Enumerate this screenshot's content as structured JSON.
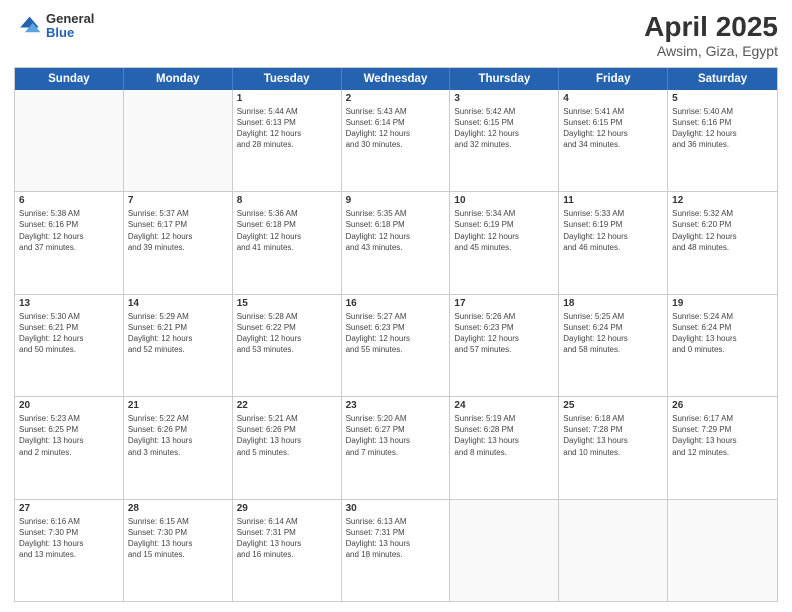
{
  "header": {
    "logo_line1": "General",
    "logo_line2": "Blue",
    "title": "April 2025",
    "subtitle": "Awsim, Giza, Egypt"
  },
  "calendar": {
    "days_of_week": [
      "Sunday",
      "Monday",
      "Tuesday",
      "Wednesday",
      "Thursday",
      "Friday",
      "Saturday"
    ],
    "weeks": [
      [
        {
          "day": "",
          "info": ""
        },
        {
          "day": "",
          "info": ""
        },
        {
          "day": "1",
          "info": "Sunrise: 5:44 AM\nSunset: 6:13 PM\nDaylight: 12 hours\nand 28 minutes."
        },
        {
          "day": "2",
          "info": "Sunrise: 5:43 AM\nSunset: 6:14 PM\nDaylight: 12 hours\nand 30 minutes."
        },
        {
          "day": "3",
          "info": "Sunrise: 5:42 AM\nSunset: 6:15 PM\nDaylight: 12 hours\nand 32 minutes."
        },
        {
          "day": "4",
          "info": "Sunrise: 5:41 AM\nSunset: 6:15 PM\nDaylight: 12 hours\nand 34 minutes."
        },
        {
          "day": "5",
          "info": "Sunrise: 5:40 AM\nSunset: 6:16 PM\nDaylight: 12 hours\nand 36 minutes."
        }
      ],
      [
        {
          "day": "6",
          "info": "Sunrise: 5:38 AM\nSunset: 6:16 PM\nDaylight: 12 hours\nand 37 minutes."
        },
        {
          "day": "7",
          "info": "Sunrise: 5:37 AM\nSunset: 6:17 PM\nDaylight: 12 hours\nand 39 minutes."
        },
        {
          "day": "8",
          "info": "Sunrise: 5:36 AM\nSunset: 6:18 PM\nDaylight: 12 hours\nand 41 minutes."
        },
        {
          "day": "9",
          "info": "Sunrise: 5:35 AM\nSunset: 6:18 PM\nDaylight: 12 hours\nand 43 minutes."
        },
        {
          "day": "10",
          "info": "Sunrise: 5:34 AM\nSunset: 6:19 PM\nDaylight: 12 hours\nand 45 minutes."
        },
        {
          "day": "11",
          "info": "Sunrise: 5:33 AM\nSunset: 6:19 PM\nDaylight: 12 hours\nand 46 minutes."
        },
        {
          "day": "12",
          "info": "Sunrise: 5:32 AM\nSunset: 6:20 PM\nDaylight: 12 hours\nand 48 minutes."
        }
      ],
      [
        {
          "day": "13",
          "info": "Sunrise: 5:30 AM\nSunset: 6:21 PM\nDaylight: 12 hours\nand 50 minutes."
        },
        {
          "day": "14",
          "info": "Sunrise: 5:29 AM\nSunset: 6:21 PM\nDaylight: 12 hours\nand 52 minutes."
        },
        {
          "day": "15",
          "info": "Sunrise: 5:28 AM\nSunset: 6:22 PM\nDaylight: 12 hours\nand 53 minutes."
        },
        {
          "day": "16",
          "info": "Sunrise: 5:27 AM\nSunset: 6:23 PM\nDaylight: 12 hours\nand 55 minutes."
        },
        {
          "day": "17",
          "info": "Sunrise: 5:26 AM\nSunset: 6:23 PM\nDaylight: 12 hours\nand 57 minutes."
        },
        {
          "day": "18",
          "info": "Sunrise: 5:25 AM\nSunset: 6:24 PM\nDaylight: 12 hours\nand 58 minutes."
        },
        {
          "day": "19",
          "info": "Sunrise: 5:24 AM\nSunset: 6:24 PM\nDaylight: 13 hours\nand 0 minutes."
        }
      ],
      [
        {
          "day": "20",
          "info": "Sunrise: 5:23 AM\nSunset: 6:25 PM\nDaylight: 13 hours\nand 2 minutes."
        },
        {
          "day": "21",
          "info": "Sunrise: 5:22 AM\nSunset: 6:26 PM\nDaylight: 13 hours\nand 3 minutes."
        },
        {
          "day": "22",
          "info": "Sunrise: 5:21 AM\nSunset: 6:26 PM\nDaylight: 13 hours\nand 5 minutes."
        },
        {
          "day": "23",
          "info": "Sunrise: 5:20 AM\nSunset: 6:27 PM\nDaylight: 13 hours\nand 7 minutes."
        },
        {
          "day": "24",
          "info": "Sunrise: 5:19 AM\nSunset: 6:28 PM\nDaylight: 13 hours\nand 8 minutes."
        },
        {
          "day": "25",
          "info": "Sunrise: 6:18 AM\nSunset: 7:28 PM\nDaylight: 13 hours\nand 10 minutes."
        },
        {
          "day": "26",
          "info": "Sunrise: 6:17 AM\nSunset: 7:29 PM\nDaylight: 13 hours\nand 12 minutes."
        }
      ],
      [
        {
          "day": "27",
          "info": "Sunrise: 6:16 AM\nSunset: 7:30 PM\nDaylight: 13 hours\nand 13 minutes."
        },
        {
          "day": "28",
          "info": "Sunrise: 6:15 AM\nSunset: 7:30 PM\nDaylight: 13 hours\nand 15 minutes."
        },
        {
          "day": "29",
          "info": "Sunrise: 6:14 AM\nSunset: 7:31 PM\nDaylight: 13 hours\nand 16 minutes."
        },
        {
          "day": "30",
          "info": "Sunrise: 6:13 AM\nSunset: 7:31 PM\nDaylight: 13 hours\nand 18 minutes."
        },
        {
          "day": "",
          "info": ""
        },
        {
          "day": "",
          "info": ""
        },
        {
          "day": "",
          "info": ""
        }
      ]
    ]
  }
}
